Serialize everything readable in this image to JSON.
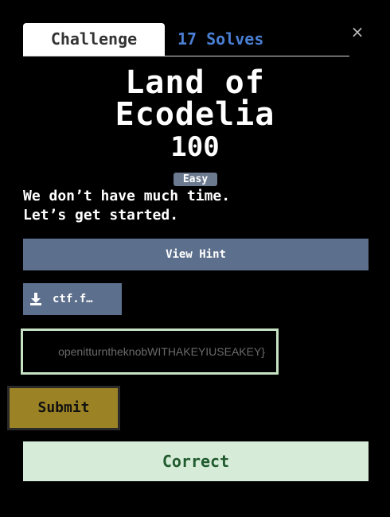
{
  "tabs": {
    "challenge_label": "Challenge",
    "solves_label": "17 Solves"
  },
  "close_icon": "×",
  "challenge": {
    "title_line1": "Land of",
    "title_line2": "Ecodelia",
    "points": "100",
    "difficulty": "Easy",
    "description_line1": "We don’t have much time.",
    "description_line2": "Let’s get started."
  },
  "actions": {
    "hint_label": "View Hint",
    "file_label": "ctf.f…",
    "file_icon": "download-icon"
  },
  "flag_input": {
    "value": "openitturntheknobWITHAKEYIUSEAKEY}"
  },
  "submit_label": "Submit",
  "result_label": "Correct",
  "colors": {
    "solves": "#4a7fd4",
    "badge": "#6c7a8f",
    "button": "#5c6f8c",
    "input_border": "#c6e2c3",
    "submit": "#9a8225",
    "success_bg": "#d6ecd8",
    "success_text": "#215a2e"
  }
}
